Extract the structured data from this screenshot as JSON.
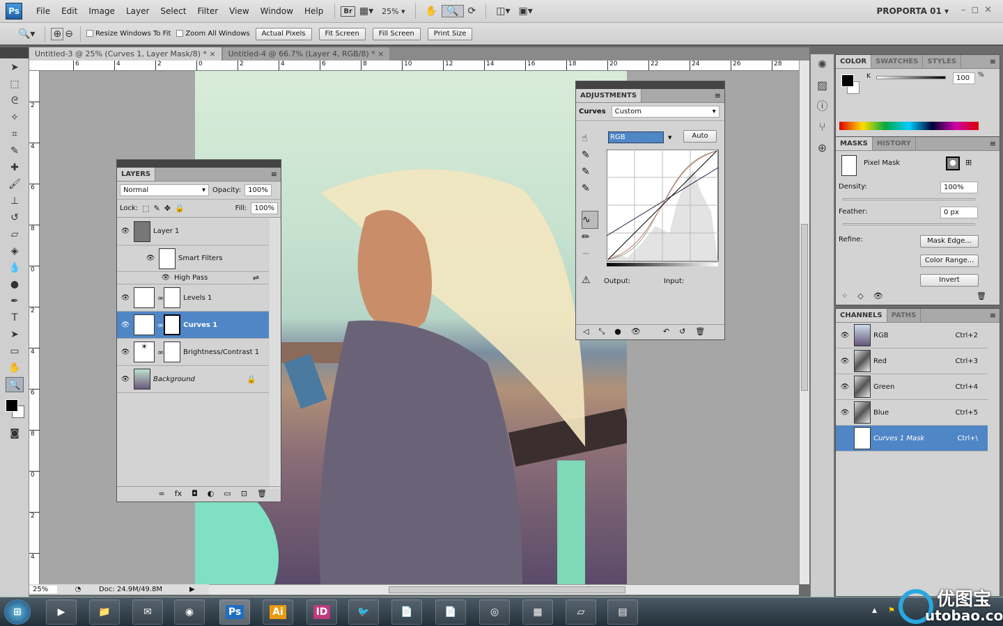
{
  "menubar": {
    "logo": "Ps",
    "items": [
      "File",
      "Edit",
      "Image",
      "Layer",
      "Select",
      "Filter",
      "View",
      "Window",
      "Help"
    ],
    "bridge": "Br",
    "zoom": "25%",
    "workspace": "PROPORTA 01"
  },
  "options": {
    "resize_windows": "Resize Windows To Fit",
    "zoom_all": "Zoom All Windows",
    "actual_pixels": "Actual Pixels",
    "fit_screen": "Fit Screen",
    "fill_screen": "Fill Screen",
    "print_size": "Print Size"
  },
  "tabs": [
    {
      "label": "Untitled-3 @ 25% (Curves 1, Layer Mask/8) *"
    },
    {
      "label": "Untitled-4 @ 66.7% (Layer 4, RGB/8) *"
    }
  ],
  "ruler": {
    "top": [
      "6",
      "4",
      "2",
      "0",
      "2",
      "4",
      "6",
      "8",
      "10",
      "12",
      "14",
      "16",
      "18",
      "20",
      "22",
      "24",
      "26",
      "28"
    ],
    "left": [
      "2",
      "4",
      "6",
      "8",
      "0",
      "2",
      "4",
      "6",
      "8",
      "0",
      "2",
      "4"
    ]
  },
  "status": {
    "zoom": "25%",
    "doc": "Doc: 24.9M/49.8M"
  },
  "layers": {
    "tab": "LAYERS",
    "blend": "Normal",
    "opacity_label": "Opacity:",
    "opacity": "100%",
    "lock_label": "Lock:",
    "fill_label": "Fill:",
    "fill": "100%",
    "items": [
      {
        "name": "Layer 1"
      },
      {
        "name": "Smart Filters"
      },
      {
        "name": "High Pass"
      },
      {
        "name": "Levels 1"
      },
      {
        "name": "Curves 1",
        "selected": true
      },
      {
        "name": "Brightness/Contrast 1"
      },
      {
        "name": "Background",
        "locked": true
      }
    ]
  },
  "adjustments": {
    "tab": "ADJUSTMENTS",
    "type": "Curves",
    "preset": "Custom",
    "channel": "RGB",
    "auto": "Auto",
    "output_label": "Output:",
    "input_label": "Input:"
  },
  "color": {
    "tabs": [
      "COLOR",
      "SWATCHES",
      "STYLES"
    ],
    "k_label": "K",
    "k_value": "100",
    "unit": "%",
    "foreground": "#000000",
    "background": "#ffffff"
  },
  "masks": {
    "tabs": [
      "MASKS",
      "HISTORY"
    ],
    "mask_type": "Pixel Mask",
    "density_label": "Density:",
    "density": "100%",
    "feather_label": "Feather:",
    "feather": "0 px",
    "refine_label": "Refine:",
    "mask_edge": "Mask Edge...",
    "color_range": "Color Range...",
    "invert": "Invert"
  },
  "channels": {
    "tabs": [
      "CHANNELS",
      "PATHS"
    ],
    "items": [
      {
        "name": "RGB",
        "key": "Ctrl+2"
      },
      {
        "name": "Red",
        "key": "Ctrl+3"
      },
      {
        "name": "Green",
        "key": "Ctrl+4"
      },
      {
        "name": "Blue",
        "key": "Ctrl+5"
      },
      {
        "name": "Curves 1 Mask",
        "key": "Ctrl+\\",
        "selected": true
      }
    ]
  },
  "taskbar": {
    "apps": [
      "start",
      "media-player",
      "explorer",
      "thunderbird",
      "firefox",
      "Ps",
      "Ai",
      "ID",
      "pidgin",
      "acrobat-reader",
      "acrobat",
      "chrome",
      "control-panel",
      "notepad",
      "odf"
    ]
  },
  "watermark": {
    "text": "优图宝",
    "url": "utobao.com"
  },
  "accent": "#4f86c6"
}
